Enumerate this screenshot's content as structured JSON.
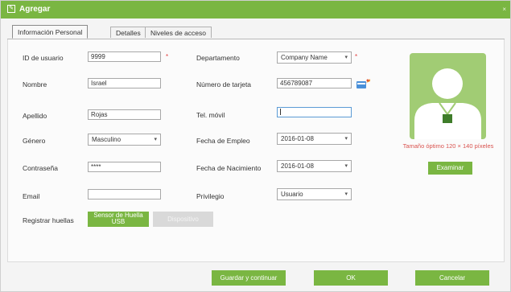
{
  "window": {
    "title": "Agregar",
    "close_label": "×"
  },
  "tabs": [
    {
      "label": "Información Personal",
      "active": true
    },
    {
      "label": "Detalles",
      "active": false
    },
    {
      "label": "Niveles de acceso",
      "active": false
    }
  ],
  "form": {
    "user_id": {
      "label": "ID de usuario",
      "value": "9999",
      "required_mark": "*"
    },
    "first_name": {
      "label": "Nombre",
      "value": "Israel"
    },
    "last_name": {
      "label": "Apellido",
      "value": "Rojas"
    },
    "gender": {
      "label": "Género",
      "value": "Masculino"
    },
    "password": {
      "label": "Contraseña",
      "value": "****"
    },
    "email": {
      "label": "Email",
      "value": ""
    },
    "fingerprint": {
      "label": "Registrar huellas",
      "usb_button_line1": "Sensor de Huella",
      "usb_button_line2": "USB",
      "device_button": "Dispositivo"
    },
    "department": {
      "label": "Departamento",
      "value": "Company Name",
      "required_mark": "*"
    },
    "card_number": {
      "label": "Número de tarjeta",
      "value": "456789087"
    },
    "mobile": {
      "label": "Tel. móvil",
      "value": ""
    },
    "hire_date": {
      "label": "Fecha de Empleo",
      "value": "2016-01-08"
    },
    "birth_date": {
      "label": "Fecha de Nacimiento",
      "value": "2016-01-08"
    },
    "privilege": {
      "label": "Privilegio",
      "value": "Usuario"
    }
  },
  "photo": {
    "hint": "Tamaño óptimo 120 × 140 píxeles",
    "browse_button": "Examinar"
  },
  "footer": {
    "save_continue": "Guardar y continuar",
    "ok": "OK",
    "cancel": "Cancelar"
  },
  "colors": {
    "accent": "#7ab642",
    "photo_bg": "#a1cc74",
    "required": "#e04040",
    "hint": "#d9534f"
  }
}
